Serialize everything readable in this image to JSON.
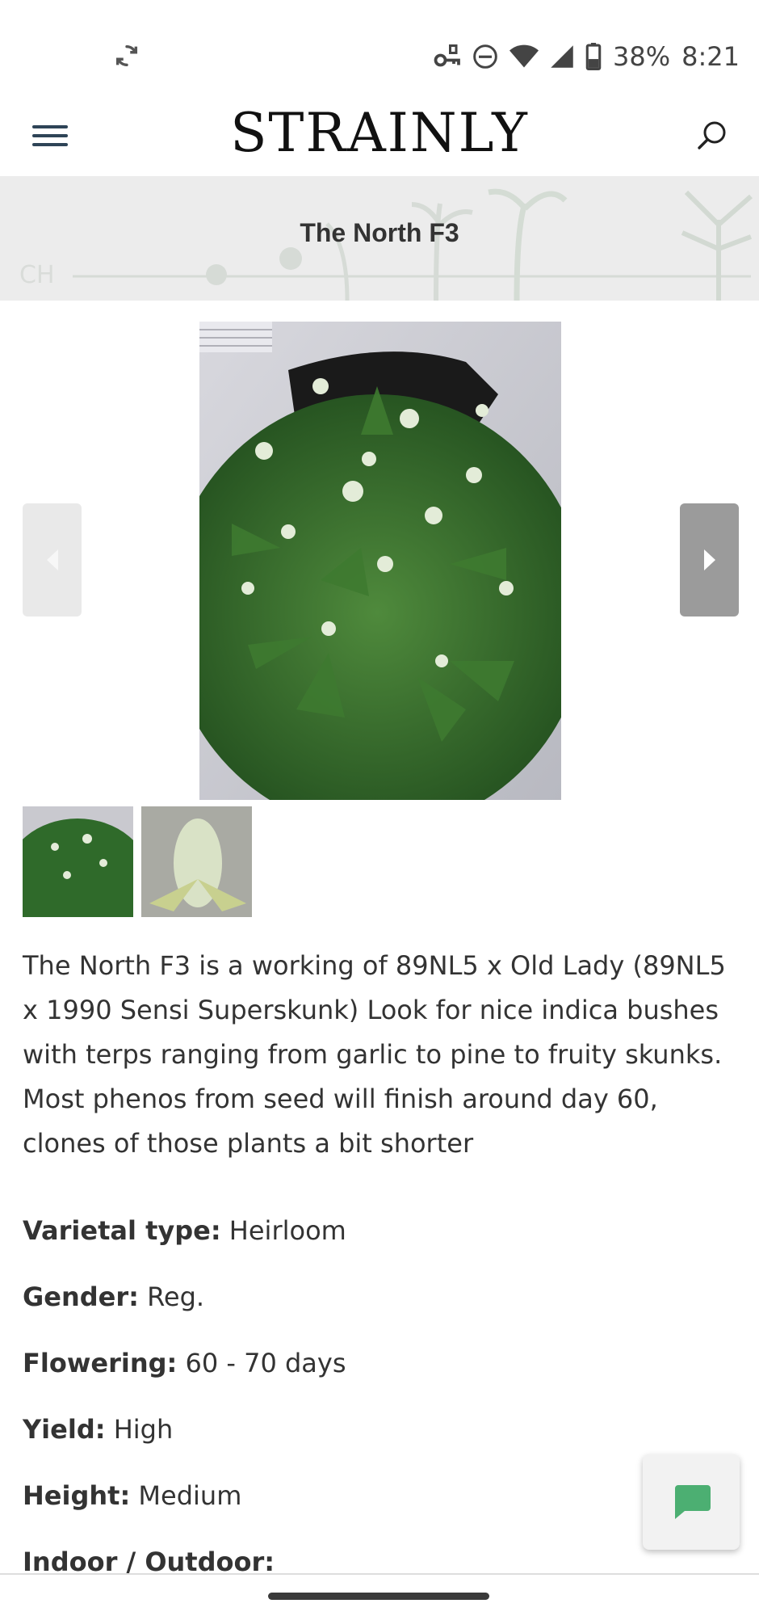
{
  "status_bar": {
    "battery": "38%",
    "time": "8:21",
    "icons": [
      "sync-icon",
      "vpn-key-icon",
      "do-not-disturb-icon",
      "wifi-icon",
      "cell-signal-icon",
      "battery-icon"
    ]
  },
  "header": {
    "logo": "STRAINLY",
    "icons": [
      "menu-icon",
      "search-icon"
    ]
  },
  "banner": {
    "title": "The North F3"
  },
  "gallery": {
    "icons": [
      "arrow-left-icon",
      "arrow-right-icon"
    ],
    "thumbnail_count": 2
  },
  "strain": {
    "description": "The North F3 is a working of 89NL5 x Old Lady (89NL5 x 1990 Sensi Superskunk) Look for nice indica bushes with terps ranging from garlic to pine to fruity skunks. Most phenos from seed will finish around day 60, clones of those plants a bit shorter",
    "specs": [
      {
        "label": "Varietal type:",
        "value": "Heirloom"
      },
      {
        "label": "Gender:",
        "value": "Reg."
      },
      {
        "label": "Flowering:",
        "value": "60 - 70 days"
      },
      {
        "label": "Yield:",
        "value": "High"
      },
      {
        "label": "Height:",
        "value": "Medium"
      },
      {
        "label": "Indoor / Outdoor:",
        "value": ""
      }
    ]
  },
  "chat": {
    "icon": "chat-icon",
    "color": "#4caf72"
  },
  "colors": {
    "menu_icon": "#2e4457",
    "banner_bg": "#ececec"
  }
}
